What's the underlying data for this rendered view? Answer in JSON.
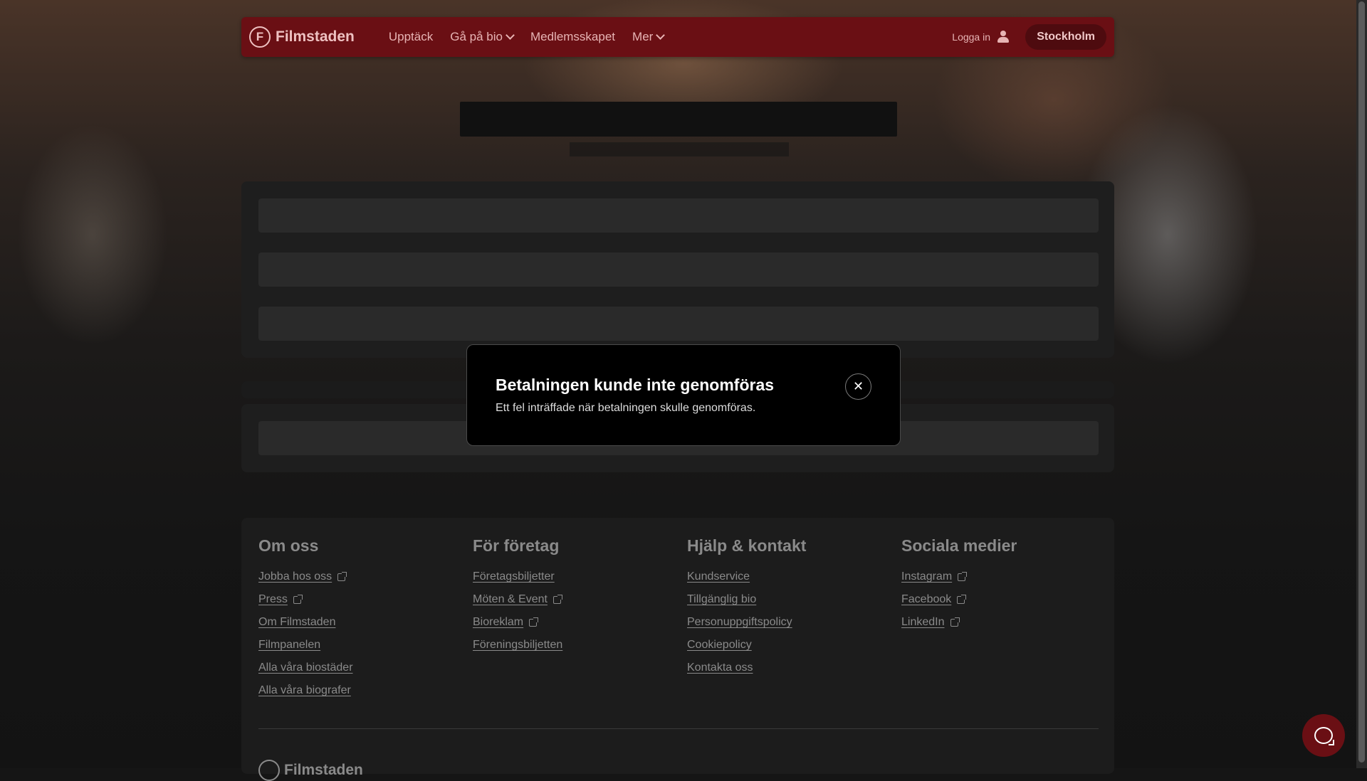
{
  "header": {
    "logo_letter": "F",
    "logo_text": "Filmstaden",
    "nav": [
      {
        "label": "Upptäck",
        "has_dropdown": false
      },
      {
        "label": "Gå på bio",
        "has_dropdown": true
      },
      {
        "label": "Medlemsskapet",
        "has_dropdown": false
      },
      {
        "label": "Mer",
        "has_dropdown": true
      }
    ],
    "login_label": "Logga in",
    "city_label": "Stockholm",
    "accent_color": "#6a0f14"
  },
  "modal": {
    "title": "Betalningen kunde inte genomföras",
    "message": "Ett fel inträffade när betalningen skulle genomföras.",
    "close_icon": "close-icon"
  },
  "footer": {
    "columns": [
      {
        "heading": "Om oss",
        "links": [
          {
            "label": "Jobba hos oss",
            "external": true
          },
          {
            "label": "Press",
            "external": true
          },
          {
            "label": "Om Filmstaden",
            "external": false
          },
          {
            "label": "Filmpanelen",
            "external": false
          },
          {
            "label": "Alla våra biostäder",
            "external": false
          },
          {
            "label": "Alla våra biografer",
            "external": false
          }
        ]
      },
      {
        "heading": "För företag",
        "links": [
          {
            "label": "Företagsbiljetter",
            "external": false
          },
          {
            "label": "Möten & Event",
            "external": true
          },
          {
            "label": "Bioreklam",
            "external": true
          },
          {
            "label": "Föreningsbiljetten",
            "external": false
          }
        ]
      },
      {
        "heading": "Hjälp & kontakt",
        "links": [
          {
            "label": "Kundservice",
            "external": false
          },
          {
            "label": "Tillgänglig bio",
            "external": false
          },
          {
            "label": "Personuppgiftspolicy",
            "external": false
          },
          {
            "label": "Cookiepolicy",
            "external": false
          },
          {
            "label": "Kontakta oss",
            "external": false
          }
        ]
      },
      {
        "heading": "Sociala medier",
        "links": [
          {
            "label": "Instagram",
            "external": true
          },
          {
            "label": "Facebook",
            "external": true
          },
          {
            "label": "LinkedIn",
            "external": true
          }
        ]
      }
    ],
    "logo_text": "Filmstaden"
  }
}
